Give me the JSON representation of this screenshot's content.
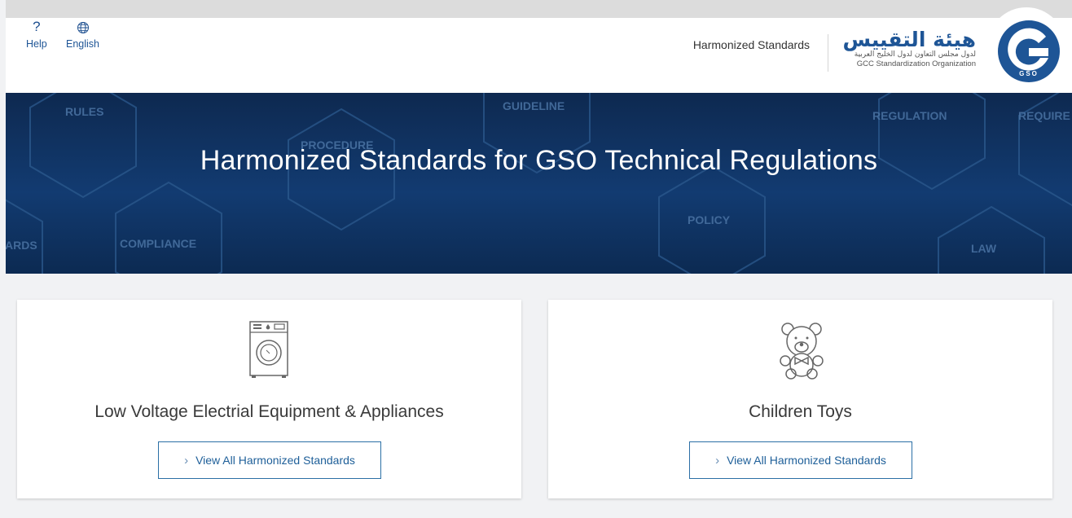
{
  "header": {
    "help_label": "Help",
    "language_label": "English",
    "nav_link": "Harmonized Standards",
    "logo": {
      "arabic_name": "هيئة التقييس",
      "arabic_sub": "لدول مجلس التعاون لدول الخليج العربية",
      "english_name": "GCC Standardization Organization",
      "badge_text": "GSO"
    }
  },
  "banner": {
    "title": "Harmonized Standards for GSO Technical Regulations",
    "bg_words": [
      "RULES",
      "PROCEDURE",
      "GUIDELINE",
      "REGULATION",
      "REQUIRE",
      "ARDS",
      "COMPLIANCE",
      "POLICY",
      "LAW"
    ]
  },
  "cards": [
    {
      "title": "Low Voltage Electrial Equipment & Appliances",
      "button": "View All Harmonized Standards",
      "icon": "washing-machine-icon"
    },
    {
      "title": "Children Toys",
      "button": "View All Harmonized Standards",
      "icon": "teddy-bear-icon"
    }
  ],
  "colors": {
    "brand": "#1e5596",
    "banner": "#123b71",
    "button_border": "#2b6fa5"
  }
}
